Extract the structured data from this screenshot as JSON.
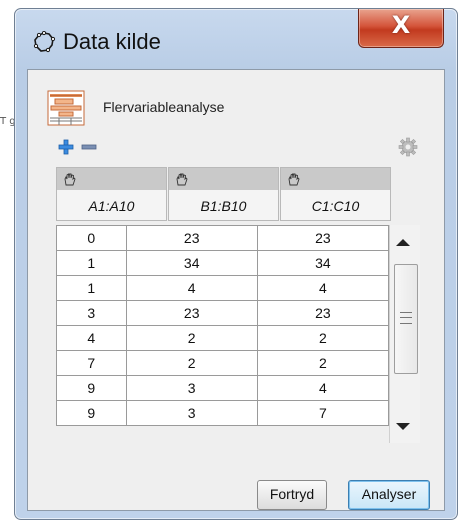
{
  "background": {
    "left_text": "T\ng"
  },
  "window": {
    "title": "Data kilde",
    "close_label": "X"
  },
  "app": {
    "name": "Flervariableanalyse"
  },
  "toolbar": {
    "add_icon": "plus-icon",
    "remove_icon": "minus-icon",
    "settings_icon": "gear-icon"
  },
  "columns": [
    {
      "label": "A1:A10"
    },
    {
      "label": "B1:B10"
    },
    {
      "label": "C1:C10"
    }
  ],
  "rows": [
    [
      "0",
      "23",
      "23"
    ],
    [
      "1",
      "34",
      "34"
    ],
    [
      "1",
      "4",
      "4"
    ],
    [
      "3",
      "23",
      "23"
    ],
    [
      "4",
      "2",
      "2"
    ],
    [
      "7",
      "2",
      "2"
    ],
    [
      "9",
      "3",
      "4"
    ],
    [
      "9",
      "3",
      "7"
    ]
  ],
  "buttons": {
    "cancel": "Fortryd",
    "ok": "Analyser"
  },
  "colors": {
    "close_button": "#c23a1f",
    "accent_plus": "#2f7fd1",
    "default_button_border": "#3c7fb1"
  }
}
